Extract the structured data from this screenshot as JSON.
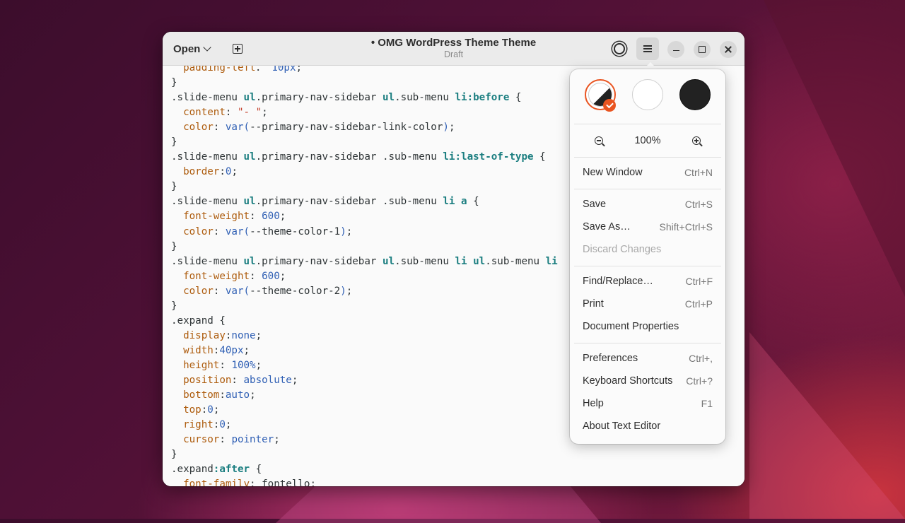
{
  "headerbar": {
    "open_label": "Open",
    "title": "• OMG WordPress Theme Theme",
    "subtitle": "Draft"
  },
  "code_lines": [
    [
      [
        "prop",
        "  padding-left"
      ],
      [
        "",
        "："
      ],
      [
        "val",
        " 10px"
      ],
      [
        "",
        ";"
      ]
    ],
    [
      [
        "",
        "}"
      ]
    ],
    [
      [
        "",
        ".slide-menu "
      ],
      [
        "tag",
        "ul"
      ],
      [
        "",
        ".primary-nav-sidebar "
      ],
      [
        "tag",
        "ul"
      ],
      [
        "",
        ".sub-menu "
      ],
      [
        "tag",
        "li"
      ],
      [
        "kw",
        ":before"
      ],
      [
        "",
        " {"
      ]
    ],
    [
      [
        "prop",
        "  content"
      ],
      [
        "",
        ": "
      ],
      [
        "str",
        "\"- \""
      ],
      [
        "",
        ";"
      ]
    ],
    [
      [
        "prop",
        "  color"
      ],
      [
        "",
        ": "
      ],
      [
        "val",
        "var("
      ],
      [
        "",
        "--primary-nav-sidebar-link-color"
      ],
      [
        "val",
        ")"
      ],
      [
        "",
        ";"
      ]
    ],
    [
      [
        "",
        "}"
      ]
    ],
    [
      [
        "",
        ".slide-menu "
      ],
      [
        "tag",
        "ul"
      ],
      [
        "",
        ".primary-nav-sidebar .sub-menu "
      ],
      [
        "tag",
        "li"
      ],
      [
        "kw",
        ":last-of-type"
      ],
      [
        "",
        " {"
      ]
    ],
    [
      [
        "prop",
        "  border"
      ],
      [
        "",
        ":"
      ],
      [
        "val",
        "0"
      ],
      [
        "",
        ";"
      ]
    ],
    [
      [
        "",
        "}"
      ]
    ],
    [
      [
        "",
        ".slide-menu "
      ],
      [
        "tag",
        "ul"
      ],
      [
        "",
        ".primary-nav-sidebar .sub-menu "
      ],
      [
        "tag",
        "li"
      ],
      [
        "",
        " "
      ],
      [
        "tag",
        "a"
      ],
      [
        "",
        " {"
      ]
    ],
    [
      [
        "prop",
        "  font-weight"
      ],
      [
        "",
        ": "
      ],
      [
        "val",
        "600"
      ],
      [
        "",
        ";"
      ]
    ],
    [
      [
        "prop",
        "  color"
      ],
      [
        "",
        ": "
      ],
      [
        "val",
        "var("
      ],
      [
        "",
        "--theme-color-1"
      ],
      [
        "val",
        ")"
      ],
      [
        "",
        ";"
      ]
    ],
    [
      [
        "",
        "}"
      ]
    ],
    [
      [
        "",
        ".slide-menu "
      ],
      [
        "tag",
        "ul"
      ],
      [
        "",
        ".primary-nav-sidebar "
      ],
      [
        "tag",
        "ul"
      ],
      [
        "",
        ".sub-menu "
      ],
      [
        "tag",
        "li"
      ],
      [
        "",
        " "
      ],
      [
        "tag",
        "ul"
      ],
      [
        "",
        ".sub-menu "
      ],
      [
        "tag",
        "li"
      ]
    ],
    [
      [
        "prop",
        "  font-weight"
      ],
      [
        "",
        ": "
      ],
      [
        "val",
        "600"
      ],
      [
        "",
        ";"
      ]
    ],
    [
      [
        "prop",
        "  color"
      ],
      [
        "",
        ": "
      ],
      [
        "val",
        "var("
      ],
      [
        "",
        "--theme-color-2"
      ],
      [
        "val",
        ")"
      ],
      [
        "",
        ";"
      ]
    ],
    [
      [
        "",
        "}"
      ]
    ],
    [
      [
        "",
        ".expand {"
      ]
    ],
    [
      [
        "prop",
        "  display"
      ],
      [
        "",
        ":"
      ],
      [
        "val",
        "none"
      ],
      [
        "",
        ";"
      ]
    ],
    [
      [
        "prop",
        "  width"
      ],
      [
        "",
        ":"
      ],
      [
        "val",
        "40px"
      ],
      [
        "",
        ";"
      ]
    ],
    [
      [
        "prop",
        "  height"
      ],
      [
        "",
        ": "
      ],
      [
        "val",
        "100%"
      ],
      [
        "",
        ";"
      ]
    ],
    [
      [
        "prop",
        "  position"
      ],
      [
        "",
        ": "
      ],
      [
        "val",
        "absolute"
      ],
      [
        "",
        ";"
      ]
    ],
    [
      [
        "prop",
        "  bottom"
      ],
      [
        "",
        ":"
      ],
      [
        "val",
        "auto"
      ],
      [
        "",
        ";"
      ]
    ],
    [
      [
        "prop",
        "  top"
      ],
      [
        "",
        ":"
      ],
      [
        "val",
        "0"
      ],
      [
        "",
        ";"
      ]
    ],
    [
      [
        "prop",
        "  right"
      ],
      [
        "",
        ":"
      ],
      [
        "val",
        "0"
      ],
      [
        "",
        ";"
      ]
    ],
    [
      [
        "prop",
        "  cursor"
      ],
      [
        "",
        ": "
      ],
      [
        "val",
        "pointer"
      ],
      [
        "",
        ";"
      ]
    ],
    [
      [
        "",
        "}"
      ]
    ],
    [
      [
        "",
        ".expand"
      ],
      [
        "kw",
        ":after"
      ],
      [
        "",
        " {"
      ]
    ],
    [
      [
        "prop",
        "  font-family"
      ],
      [
        "",
        ": "
      ],
      [
        "",
        "fontello;"
      ]
    ]
  ],
  "menu": {
    "zoom_level": "100%",
    "items": [
      {
        "label": "New Window",
        "accel": "Ctrl+N",
        "disabled": false
      },
      {
        "label": "Save",
        "accel": "Ctrl+S",
        "disabled": false
      },
      {
        "label": "Save As…",
        "accel": "Shift+Ctrl+S",
        "disabled": false
      },
      {
        "label": "Discard Changes",
        "accel": "",
        "disabled": true
      },
      {
        "label": "Find/Replace…",
        "accel": "Ctrl+F",
        "disabled": false
      },
      {
        "label": "Print",
        "accel": "Ctrl+P",
        "disabled": false
      },
      {
        "label": "Document Properties",
        "accel": "",
        "disabled": false
      },
      {
        "label": "Preferences",
        "accel": "Ctrl+,",
        "disabled": false
      },
      {
        "label": "Keyboard Shortcuts",
        "accel": "Ctrl+?",
        "disabled": false
      },
      {
        "label": "Help",
        "accel": "F1",
        "disabled": false
      },
      {
        "label": "About Text Editor",
        "accel": "",
        "disabled": false
      }
    ]
  },
  "colors": {
    "accent": "#e95420",
    "window_bg": "#fafafa",
    "headerbar_bg": "#ebebeb"
  }
}
